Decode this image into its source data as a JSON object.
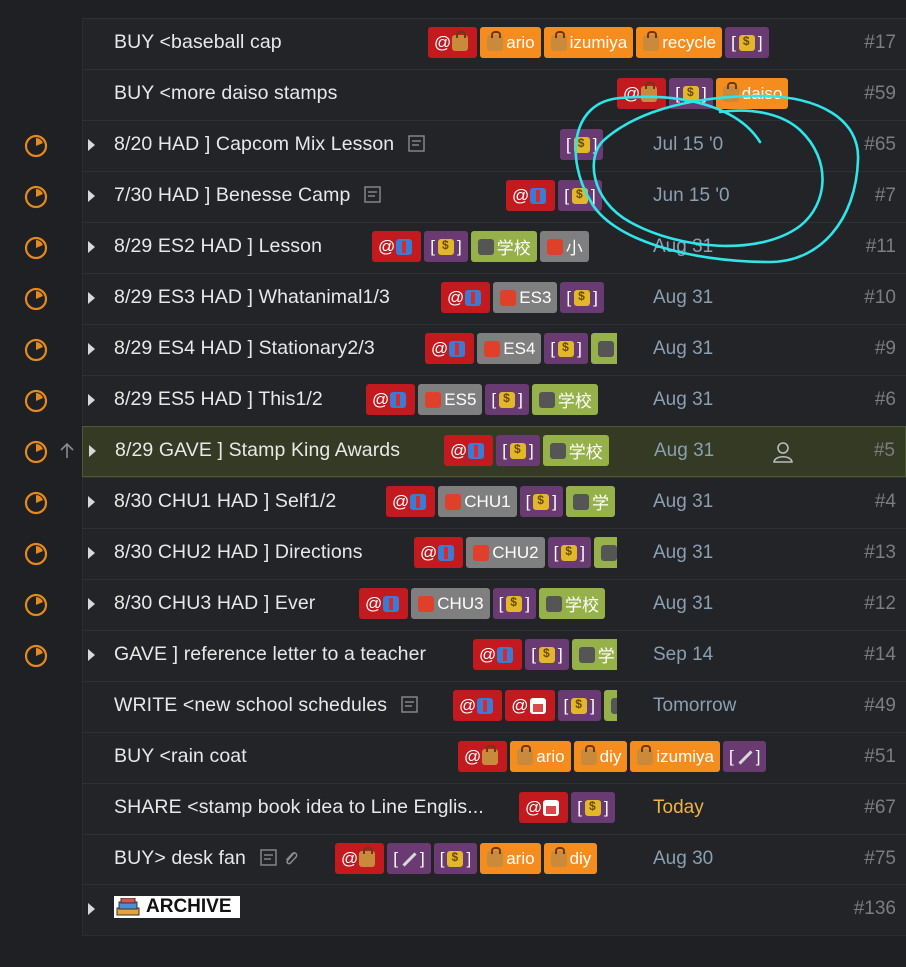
{
  "rows": [
    {
      "title": "BUY <baseball cap",
      "num": "#17",
      "date": "",
      "timer": false,
      "caret": false,
      "tags": [
        {
          "t": "@",
          "icon": "bag",
          "c": "red"
        },
        {
          "t": "ario",
          "icon": "bag",
          "c": "orange"
        },
        {
          "t": "izumiya",
          "icon": "bag",
          "c": "orange"
        },
        {
          "t": "recycle",
          "icon": "bag",
          "c": "orange"
        },
        {
          "t": "[ ]",
          "icon": "money",
          "c": "purple"
        }
      ]
    },
    {
      "title": "BUY <more daiso stamps",
      "num": "#59",
      "date": "",
      "timer": false,
      "caret": false,
      "tags": [
        {
          "t": "@",
          "icon": "bag",
          "c": "red"
        },
        {
          "t": "[ ]",
          "icon": "money",
          "c": "purple"
        },
        {
          "t": "daiso",
          "icon": "bag",
          "c": "orange"
        }
      ]
    },
    {
      "title": "8/20 HAD ] Capcom Mix Lesson",
      "num": "#65",
      "date": "Jul 15 '0",
      "timer": true,
      "caret": true,
      "note": true,
      "tags": [
        {
          "t": "[ ]",
          "icon": "money",
          "c": "purple"
        }
      ]
    },
    {
      "title": "7/30 HAD ] Benesse Camp",
      "num": "#7",
      "date": "Jun 15 '0",
      "timer": true,
      "caret": true,
      "note": true,
      "tags": [
        {
          "t": "@",
          "icon": "suit",
          "c": "red"
        },
        {
          "t": "[ ]",
          "icon": "money",
          "c": "purple"
        }
      ]
    },
    {
      "title": "8/29 ES2 HAD ] Lesson",
      "num": "#11",
      "date": "Aug 31",
      "timer": true,
      "caret": true,
      "tags": [
        {
          "t": "@",
          "icon": "suit",
          "c": "red"
        },
        {
          "t": "[ ]",
          "icon": "money",
          "c": "purple"
        },
        {
          "t": "学校",
          "icon": "person",
          "c": "green"
        },
        {
          "t": "小",
          "icon": "shirt",
          "c": "gray"
        }
      ]
    },
    {
      "title": "8/29 ES3 HAD ] Whatanimal1/3",
      "num": "#10",
      "date": "Aug 31",
      "timer": true,
      "caret": true,
      "tags": [
        {
          "t": "@",
          "icon": "suit",
          "c": "red"
        },
        {
          "t": "ES3",
          "icon": "shirt",
          "c": "gray"
        },
        {
          "t": "[ ]",
          "icon": "money",
          "c": "purple"
        }
      ]
    },
    {
      "title": "8/29 ES4 HAD ] Stationary2/3",
      "num": "#9",
      "date": "Aug 31",
      "timer": true,
      "caret": true,
      "tags": [
        {
          "t": "@",
          "icon": "suit",
          "c": "red"
        },
        {
          "t": "ES4",
          "icon": "shirt",
          "c": "gray"
        },
        {
          "t": "[ ]",
          "icon": "money",
          "c": "purple"
        },
        {
          "t": "",
          "icon": "person",
          "c": "green"
        }
      ]
    },
    {
      "title": "8/29 ES5 HAD ] This1/2",
      "num": "#6",
      "date": "Aug 31",
      "timer": true,
      "caret": true,
      "tags": [
        {
          "t": "@",
          "icon": "suit",
          "c": "red"
        },
        {
          "t": "ES5",
          "icon": "shirt",
          "c": "gray"
        },
        {
          "t": "[ ]",
          "icon": "money",
          "c": "purple"
        },
        {
          "t": "学校",
          "icon": "person",
          "c": "green"
        }
      ]
    },
    {
      "title": "8/29 GAVE ] Stamp King Awards",
      "num": "#5",
      "date": "Aug 31",
      "timer": true,
      "caret": true,
      "selected": true,
      "assignee": true,
      "uparrow": true,
      "tags": [
        {
          "t": "@",
          "icon": "suit",
          "c": "red"
        },
        {
          "t": "[ ]",
          "icon": "money",
          "c": "purple"
        },
        {
          "t": "学校",
          "icon": "person",
          "c": "green"
        }
      ]
    },
    {
      "title": "8/30 CHU1 HAD ] Self1/2",
      "num": "#4",
      "date": "Aug 31",
      "timer": true,
      "caret": true,
      "tags": [
        {
          "t": "@",
          "icon": "suit",
          "c": "red"
        },
        {
          "t": "CHU1",
          "icon": "shirt",
          "c": "gray"
        },
        {
          "t": "[ ]",
          "icon": "money",
          "c": "purple"
        },
        {
          "t": "学",
          "icon": "person",
          "c": "green"
        }
      ]
    },
    {
      "title": "8/30 CHU2 HAD ] Directions",
      "num": "#13",
      "date": "Aug 31",
      "timer": true,
      "caret": true,
      "tags": [
        {
          "t": "@",
          "icon": "suit",
          "c": "red"
        },
        {
          "t": "CHU2",
          "icon": "shirt",
          "c": "gray"
        },
        {
          "t": "[ ]",
          "icon": "money",
          "c": "purple"
        },
        {
          "t": "",
          "icon": "person",
          "c": "green"
        }
      ]
    },
    {
      "title": "8/30 CHU3 HAD ] Ever",
      "num": "#12",
      "date": "Aug 31",
      "timer": true,
      "caret": true,
      "tags": [
        {
          "t": "@",
          "icon": "suit",
          "c": "red"
        },
        {
          "t": "CHU3",
          "icon": "shirt",
          "c": "gray"
        },
        {
          "t": "[ ]",
          "icon": "money",
          "c": "purple"
        },
        {
          "t": "学校",
          "icon": "person",
          "c": "green"
        }
      ]
    },
    {
      "title": "GAVE ] reference letter to a teacher",
      "num": "#14",
      "date": "Sep 14",
      "timer": true,
      "caret": true,
      "tags": [
        {
          "t": "@",
          "icon": "suit",
          "c": "red"
        },
        {
          "t": "[ ]",
          "icon": "money",
          "c": "purple"
        },
        {
          "t": "学",
          "icon": "person",
          "c": "green"
        }
      ]
    },
    {
      "title": "WRITE <new school schedules",
      "num": "#49",
      "date": "Tomorrow",
      "timer": false,
      "caret": false,
      "note": true,
      "tags": [
        {
          "t": "@",
          "icon": "suit",
          "c": "red"
        },
        {
          "t": "@",
          "icon": "house",
          "c": "red"
        },
        {
          "t": "[ ]",
          "icon": "money",
          "c": "purple"
        },
        {
          "t": "",
          "icon": "person",
          "c": "green"
        }
      ]
    },
    {
      "title": "BUY <rain coat",
      "num": "#51",
      "date": "",
      "timer": false,
      "caret": false,
      "tags": [
        {
          "t": "@",
          "icon": "bag",
          "c": "red"
        },
        {
          "t": "ario",
          "icon": "bag",
          "c": "orange"
        },
        {
          "t": "diy",
          "icon": "bag",
          "c": "orange"
        },
        {
          "t": "izumiya",
          "icon": "bag",
          "c": "orange"
        },
        {
          "t": "[ ]",
          "icon": "tool",
          "c": "purple"
        }
      ]
    },
    {
      "title": "SHARE <stamp book idea to Line Englis...",
      "num": "#67",
      "date": "Today",
      "today": true,
      "timer": false,
      "caret": false,
      "tags": [
        {
          "t": "@",
          "icon": "house",
          "c": "red"
        },
        {
          "t": "[ ]",
          "icon": "money",
          "c": "purple"
        }
      ]
    },
    {
      "title": "BUY> desk fan",
      "num": "#75",
      "date": "Aug 30",
      "timer": false,
      "caret": false,
      "note": true,
      "clip": true,
      "tags": [
        {
          "t": "@",
          "icon": "bag",
          "c": "red"
        },
        {
          "t": "[ ]",
          "icon": "tool",
          "c": "purple"
        },
        {
          "t": "[ ]",
          "icon": "money",
          "c": "purple"
        },
        {
          "t": "ario",
          "icon": "bag",
          "c": "orange"
        },
        {
          "t": "diy",
          "icon": "bag",
          "c": "orange"
        }
      ]
    }
  ],
  "archive": {
    "label": "ARCHIVE",
    "num": "#136"
  }
}
